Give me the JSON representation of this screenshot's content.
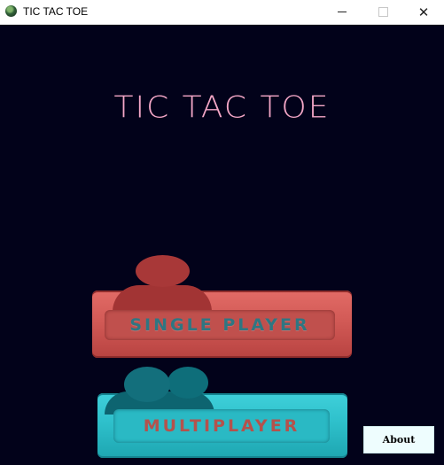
{
  "window": {
    "title": "TIC TAC TOE",
    "minimize_glyph": "",
    "maximize_glyph": "",
    "close_glyph": "✕"
  },
  "game": {
    "title": "TIC TAC TOE",
    "title_color": "#f4a7c7",
    "background_color": "#02021a"
  },
  "buttons": {
    "single_player": {
      "label": "SINGLE PLAYER",
      "icon": "single-user-icon",
      "color": "#d25a56"
    },
    "multiplayer": {
      "label": "MULTIPLAYER",
      "icon": "multi-user-icon",
      "color": "#2ec0cb"
    },
    "about": {
      "label": "About"
    }
  }
}
